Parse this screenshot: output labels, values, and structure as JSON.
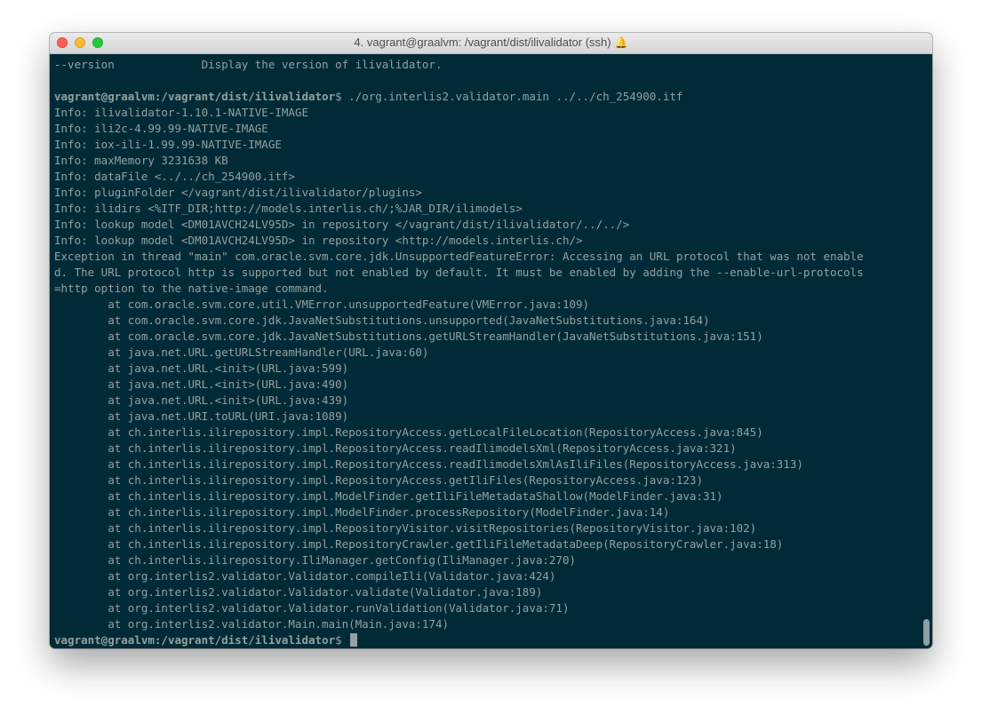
{
  "window": {
    "title": "4. vagrant@graalvm: /vagrant/dist/ilivalidator (ssh)",
    "bell_icon": "bell-icon",
    "background_color": "#002b36",
    "text_color": "#93a1a1"
  },
  "terminal": {
    "lines": [
      "--version             Display the version of ilivalidator.",
      "",
      "Info: ilivalidator-1.10.1-NATIVE-IMAGE",
      "Info: ili2c-4.99.99-NATIVE-IMAGE",
      "Info: iox-ili-1.99.99-NATIVE-IMAGE",
      "Info: maxMemory 3231638 KB",
      "Info: dataFile <../../ch_254900.itf>",
      "Info: pluginFolder </vagrant/dist/ilivalidator/plugins>",
      "Info: ilidirs <%ITF_DIR;http://models.interlis.ch/;%JAR_DIR/ilimodels>",
      "Info: lookup model <DM01AVCH24LV95D> in repository </vagrant/dist/ilivalidator/../../>",
      "Info: lookup model <DM01AVCH24LV95D> in repository <http://models.interlis.ch/>",
      "Exception in thread \"main\" com.oracle.svm.core.jdk.UnsupportedFeatureError: Accessing an URL protocol that was not enable",
      "d. The URL protocol http is supported but not enabled by default. It must be enabled by adding the --enable-url-protocols",
      "=http option to the native-image command.",
      "        at com.oracle.svm.core.util.VMError.unsupportedFeature(VMError.java:109)",
      "        at com.oracle.svm.core.jdk.JavaNetSubstitutions.unsupported(JavaNetSubstitutions.java:164)",
      "        at com.oracle.svm.core.jdk.JavaNetSubstitutions.getURLStreamHandler(JavaNetSubstitutions.java:151)",
      "        at java.net.URL.getURLStreamHandler(URL.java:60)",
      "        at java.net.URL.<init>(URL.java:599)",
      "        at java.net.URL.<init>(URL.java:490)",
      "        at java.net.URL.<init>(URL.java:439)",
      "        at java.net.URI.toURL(URI.java:1089)",
      "        at ch.interlis.ilirepository.impl.RepositoryAccess.getLocalFileLocation(RepositoryAccess.java:845)",
      "        at ch.interlis.ilirepository.impl.RepositoryAccess.readIlimodelsXml(RepositoryAccess.java:321)",
      "        at ch.interlis.ilirepository.impl.RepositoryAccess.readIlimodelsXmlAsIliFiles(RepositoryAccess.java:313)",
      "        at ch.interlis.ilirepository.impl.RepositoryAccess.getIliFiles(RepositoryAccess.java:123)",
      "        at ch.interlis.ilirepository.impl.ModelFinder.getIliFileMetadataShallow(ModelFinder.java:31)",
      "        at ch.interlis.ilirepository.impl.ModelFinder.processRepository(ModelFinder.java:14)",
      "        at ch.interlis.ilirepository.impl.RepositoryVisitor.visitRepositories(RepositoryVisitor.java:102)",
      "        at ch.interlis.ilirepository.impl.RepositoryCrawler.getIliFileMetadataDeep(RepositoryCrawler.java:18)",
      "        at ch.interlis.ilirepository.IliManager.getConfig(IliManager.java:270)",
      "        at org.interlis2.validator.Validator.compileIli(Validator.java:424)",
      "        at org.interlis2.validator.Validator.validate(Validator.java:189)",
      "        at org.interlis2.validator.Validator.runValidation(Validator.java:71)",
      "        at org.interlis2.validator.Main.main(Main.java:174)"
    ],
    "command_prompt": {
      "user_host": "vagrant@graalvm:",
      "path": "/vagrant/dist/ilivalidator",
      "symbol": "$",
      "command": " ./org.interlis2.validator.main ../../ch_254900.itf"
    },
    "final_prompt": {
      "user_host": "vagrant@graalvm:",
      "path": "/vagrant/dist/ilivalidator",
      "symbol": "$"
    }
  }
}
